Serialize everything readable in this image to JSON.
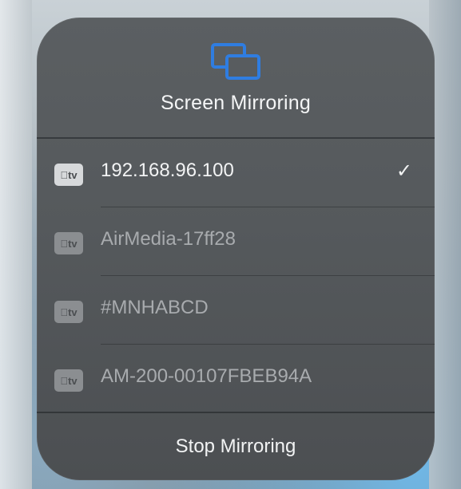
{
  "screen_mirroring": {
    "title": "Screen Mirroring",
    "icon": "screen-mirroring-icon",
    "accent_color": "#2f7de1",
    "devices": [
      {
        "badge": "tv",
        "badge_icon": "apple-tv-icon",
        "name": "192.168.96.100",
        "selected": true,
        "check": "✓"
      },
      {
        "badge": "tv",
        "badge_icon": "apple-tv-icon",
        "name": "AirMedia-17ff28",
        "selected": false
      },
      {
        "badge": "tv",
        "badge_icon": "apple-tv-icon",
        "name": "#MNHABCD",
        "selected": false
      },
      {
        "badge": "tv",
        "badge_icon": "apple-tv-icon",
        "name": "AM-200-00107FBEB94A",
        "selected": false
      }
    ],
    "stop_label": "Stop Mirroring"
  }
}
